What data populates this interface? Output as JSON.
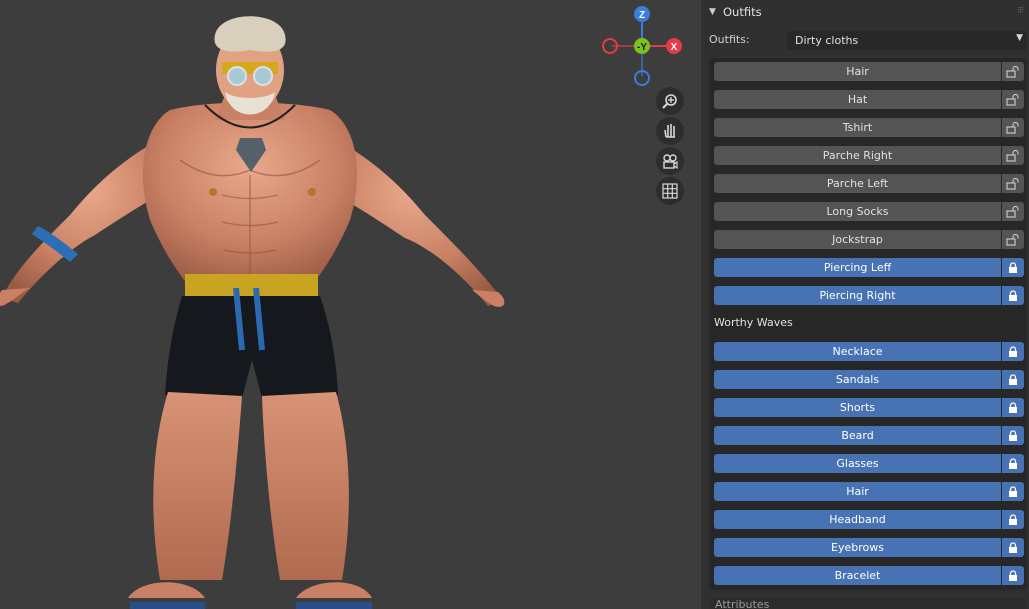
{
  "outfits_panel": {
    "title": "Outfits",
    "outfits_label": "Outfits:",
    "outfits_value": "Dirty cloths",
    "pieces": [
      {
        "label": "Hair",
        "locked": false
      },
      {
        "label": "Hat",
        "locked": false
      },
      {
        "label": "Tshirt",
        "locked": false
      },
      {
        "label": "Parche Right",
        "locked": false
      },
      {
        "label": "Parche Left",
        "locked": false
      },
      {
        "label": "Long Socks",
        "locked": false
      },
      {
        "label": "Jockstrap",
        "locked": false
      },
      {
        "label": "Piercing Leff",
        "locked": true
      },
      {
        "label": "Piercing Right",
        "locked": true
      }
    ],
    "section_title": "Worthy Waves",
    "section_pieces": [
      {
        "label": "Necklace",
        "locked": true
      },
      {
        "label": "Sandals",
        "locked": true
      },
      {
        "label": "Shorts",
        "locked": true
      },
      {
        "label": "Beard",
        "locked": true
      },
      {
        "label": "Glasses",
        "locked": true
      },
      {
        "label": "Hair",
        "locked": true
      },
      {
        "label": "Headband",
        "locked": true
      },
      {
        "label": "Eyebrows",
        "locked": true
      },
      {
        "label": "Bracelet",
        "locked": true
      }
    ],
    "next_section_title": "Attributes"
  },
  "gizmo": {
    "z_label": "Z",
    "y_label": "-Y",
    "x_label": "X"
  },
  "viewport_tools": [
    "zoom-icon",
    "hand-pan-icon",
    "camera-icon",
    "grid-icon"
  ],
  "colors": {
    "accent": "#4772b3",
    "x_axis": "#e8394a",
    "y_axis": "#7cc11e",
    "z_axis": "#3b7ddb"
  }
}
